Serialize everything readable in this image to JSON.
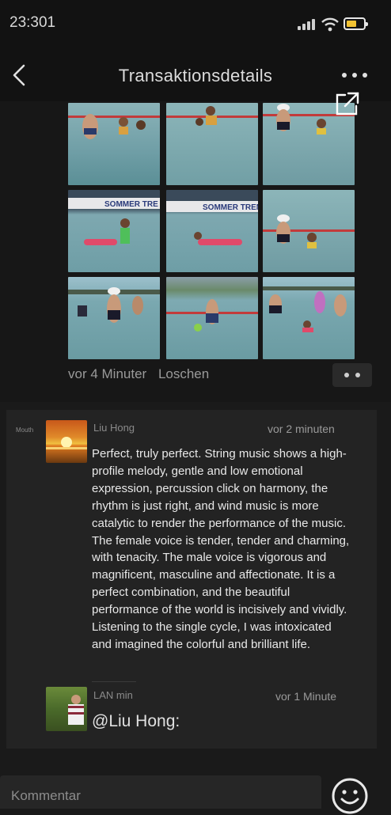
{
  "status": {
    "time": "23:301"
  },
  "nav": {
    "title": "Transaktionsdetails"
  },
  "post": {
    "photos": [
      {
        "label": ""
      },
      {
        "label": ""
      },
      {
        "label": ""
      },
      {
        "label": "SOMMER TRE"
      },
      {
        "label": "SOMMER TREND"
      },
      {
        "label": ""
      },
      {
        "label": ""
      },
      {
        "label": ""
      },
      {
        "label": ""
      }
    ],
    "time_ago": "vor 4 Minuter",
    "delete_label": "Loschen"
  },
  "comments": {
    "section_label": "Mouth",
    "items": [
      {
        "author": "Liu Hong",
        "time": "vor 2 minuten",
        "text": "Perfect, truly perfect. String music shows a high-profile melody, gentle and low emotional expression, percussion click on harmony, the rhythm is just right, and wind music is more catalytic to render the performance of the music. The female voice is tender, tender and charming, with tenacity. The male voice is vigorous and magnificent, masculine and affectionate. It is a perfect combination, and the beautiful performance of the world is incisively and vividly. Listening to the single cycle, I was intoxicated and imagined the colorful and brilliant life."
      },
      {
        "author": "LAN min",
        "time": "vor 1 Minute",
        "text": "@Liu Hong:"
      }
    ]
  },
  "input": {
    "placeholder": "Kommentar"
  },
  "icons": {
    "back": "chevron-left-icon",
    "more": "more-dots-icon",
    "share": "external-link-icon",
    "emoji": "smiley-icon"
  },
  "colors": {
    "background": "#1a1a1a",
    "comment_card": "#232323",
    "battery": "#f1c232"
  }
}
